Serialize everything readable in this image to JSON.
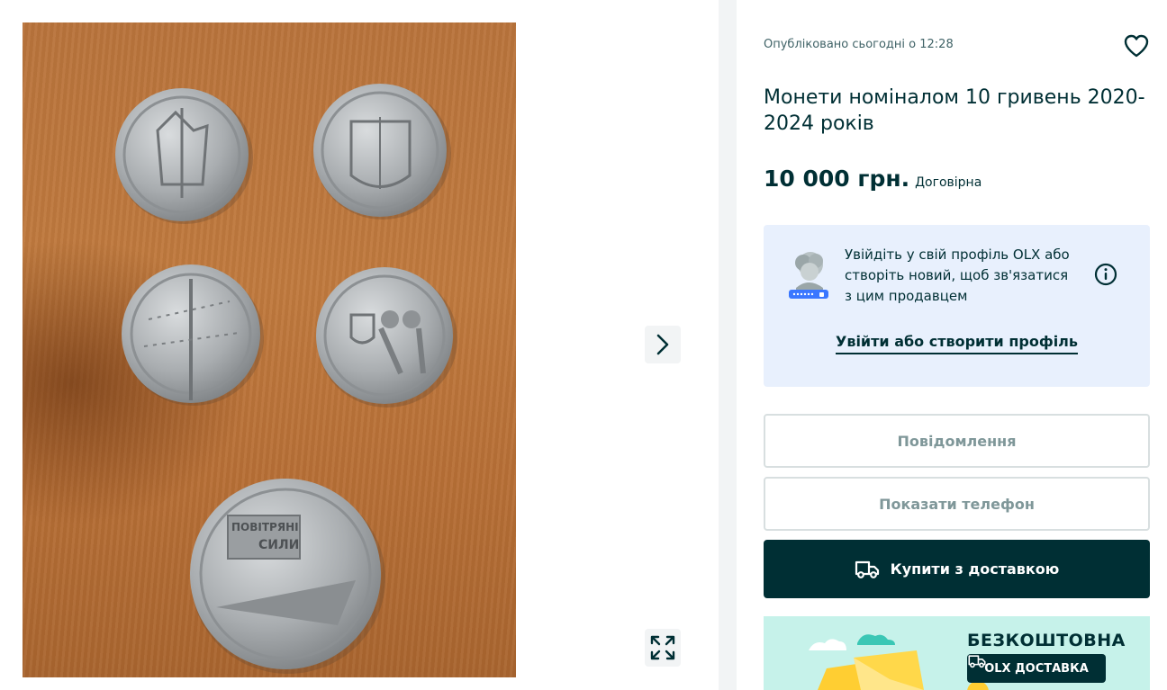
{
  "gallery": {
    "next_icon": "chevron-right-icon",
    "fullscreen_icon": "expand-icon"
  },
  "ad": {
    "published": "Опубліковано сьогодні о 12:28",
    "favorite_icon": "heart-icon",
    "title": "Монети номіналом 10 гривень 2020-2024 років",
    "price": "10 000 грн.",
    "negotiable": "Договірна"
  },
  "login_card": {
    "text": "Увійдіть у свій профіль OLX або створіть новий, щоб зв'язатися з цим продавцем",
    "link": "Увійти або створити профіль",
    "info_icon": "info-icon"
  },
  "actions": {
    "message": "Повідомлення",
    "phone": "Показати телефон",
    "buy": "Купити з доставкою",
    "buy_icon": "truck-icon"
  },
  "promo": {
    "title": "БЕЗКОШТОВНА",
    "badge": "OLX ДОСТАВКА",
    "badge_icon": "truck-icon"
  },
  "colors": {
    "brand_dark": "#002f34",
    "card_bg": "#e8f0fd",
    "promo_bg": "#c6f2ea",
    "outline": "#d8dfe0",
    "muted_text": "#7f9799"
  }
}
